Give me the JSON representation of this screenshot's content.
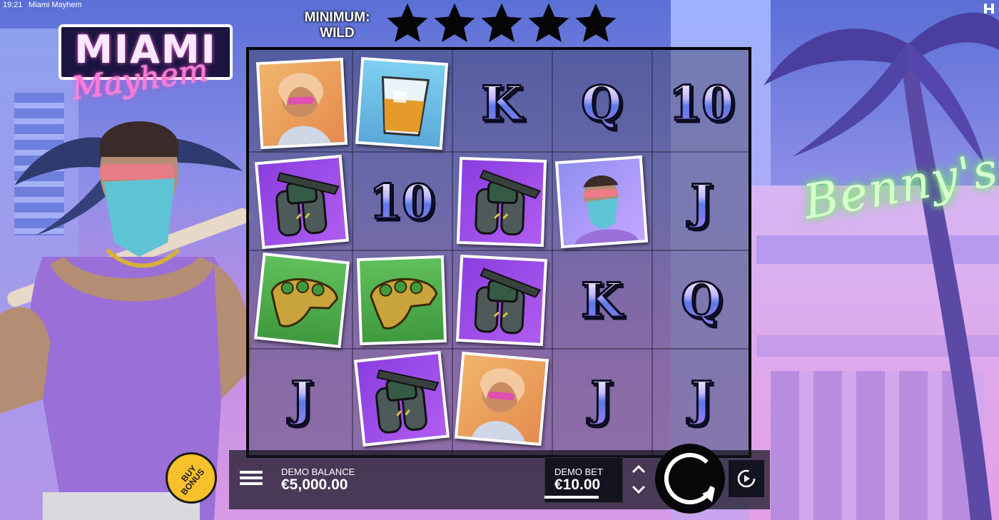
{
  "topbar": {
    "time": "19:21",
    "title": "Miami Mayhem"
  },
  "logo": {
    "main": "MIAMI",
    "script": "Mayhem"
  },
  "header": {
    "minimum_wild": "MINIMUM: WILD",
    "stars": 5,
    "star_icon": "star-icon"
  },
  "background": {
    "sign": "Benny's"
  },
  "reels": {
    "columns": 5,
    "rows": 4,
    "grid": [
      [
        "woman-card",
        "whiskey-card",
        "K",
        "Q",
        "10"
      ],
      [
        "jetpack-card",
        "10",
        "jetpack-card",
        "man-card",
        "J"
      ],
      [
        "knuckles-card",
        "knuckles-card",
        "jetpack-card",
        "K",
        "Q"
      ],
      [
        "J",
        "jetpack-card",
        "woman-card",
        "J",
        "J"
      ]
    ]
  },
  "controls": {
    "buy_bonus_line1": "BUY",
    "buy_bonus_line2": "BONUS",
    "balance_label": "DEMO BALANCE",
    "balance_value": "€5,000.00",
    "bet_label": "DEMO BET",
    "bet_value": "€10.00"
  },
  "colors": {
    "accent_yellow": "#f6c12a",
    "neon_pink": "#ff7ad9",
    "neon_green": "#7dff6a",
    "panel": "#141421"
  }
}
